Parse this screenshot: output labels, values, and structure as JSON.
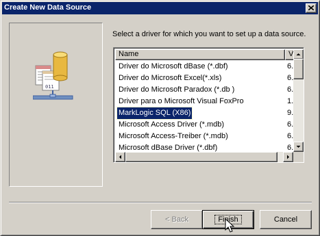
{
  "window": {
    "title": "Create New Data Source",
    "close_glyph": "×"
  },
  "instruction": "Select a driver for which you want to set up a data source.",
  "list": {
    "columns": [
      "Name",
      "V"
    ],
    "rows": [
      {
        "name": "Driver do Microsoft dBase (*.dbf)",
        "version": "6."
      },
      {
        "name": "Driver do Microsoft Excel(*.xls)",
        "version": "6."
      },
      {
        "name": "Driver do Microsoft Paradox (*.db )",
        "version": "6."
      },
      {
        "name": "Driver para o Microsoft Visual FoxPro",
        "version": "1."
      },
      {
        "name": "MarkLogic SQL (X86)",
        "version": "9.",
        "selected": true
      },
      {
        "name": "Microsoft Access Driver (*.mdb)",
        "version": "6."
      },
      {
        "name": "Microsoft Access-Treiber (*.mdb)",
        "version": "6."
      },
      {
        "name": "Microsoft dBase Driver (*.dbf)",
        "version": "6."
      }
    ]
  },
  "buttons": {
    "back": "< Back",
    "finish": "Finish",
    "cancel": "Cancel"
  },
  "art": {
    "icon": "database-driver-icon"
  },
  "colors": {
    "titlebar": "#0a246a",
    "selection": "#0a246a",
    "face": "#d4d0c8"
  }
}
